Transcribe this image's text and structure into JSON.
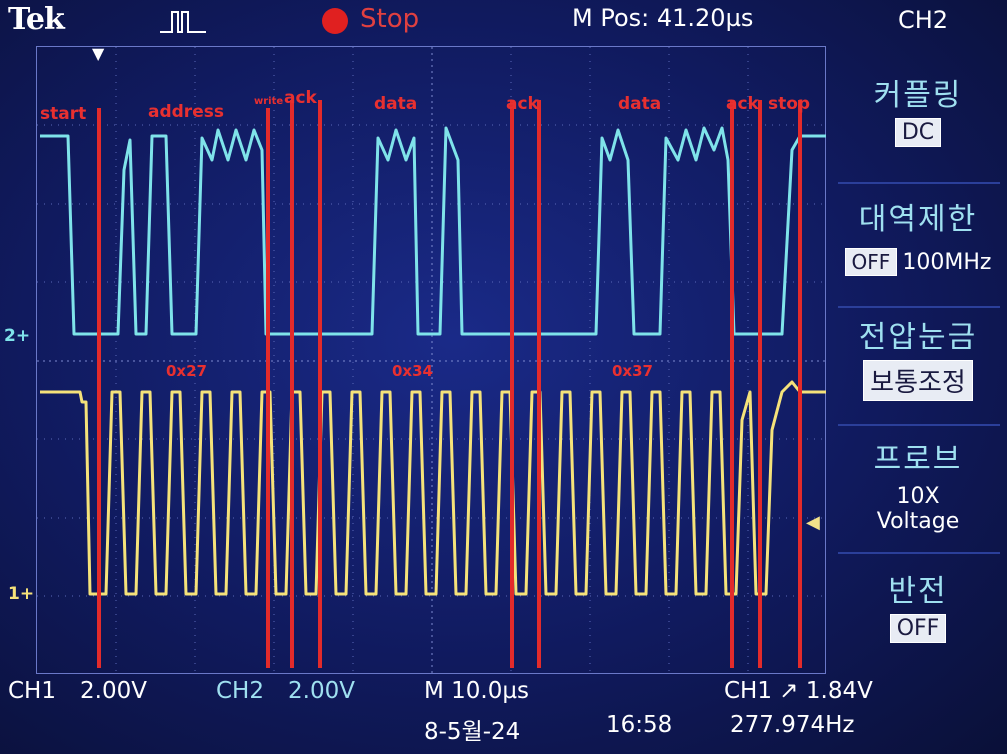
{
  "header": {
    "brand": "Tek",
    "trigger_icon": "pulse-trigger-icon",
    "run_state": "Stop",
    "m_pos": "M Pos: 41.20µs",
    "selected_channel": "CH2"
  },
  "side_menu": {
    "coupling": {
      "title": "커플링",
      "value": "DC"
    },
    "bandwidth": {
      "title": "대역제한",
      "state": "OFF",
      "value": "100MHz"
    },
    "volts_div": {
      "title": "전압눈금",
      "value": "보통조정"
    },
    "probe": {
      "title": "프로브",
      "line1": "10X",
      "line2": "Voltage"
    },
    "invert": {
      "title": "반전",
      "value": "OFF"
    }
  },
  "annotations": {
    "start": "start",
    "address": "address",
    "write": "write",
    "ack1": "ack",
    "data1": "data",
    "ack2": "ack",
    "data2": "data",
    "ack3": "ack",
    "stop": "stop",
    "hex1": "0x27",
    "hex2": "0x34",
    "hex3": "0x37"
  },
  "channel_markers": {
    "ch2": "2+",
    "ch1": "1+"
  },
  "bottom": {
    "ch1_label": "CH1",
    "ch1_scale": "2.00V",
    "ch2_label": "CH2",
    "ch2_scale": "2.00V",
    "timebase": "M 10.0µs",
    "trigger": "CH1 ↗ 1.84V",
    "date": "8-5월-24",
    "time": "16:58",
    "frequency": "277.974Hz"
  },
  "colors": {
    "ch1_trace": "#f5e27a",
    "ch2_trace": "#7fe3ea",
    "annotation": "#e32b2b",
    "background": "#14206e"
  }
}
